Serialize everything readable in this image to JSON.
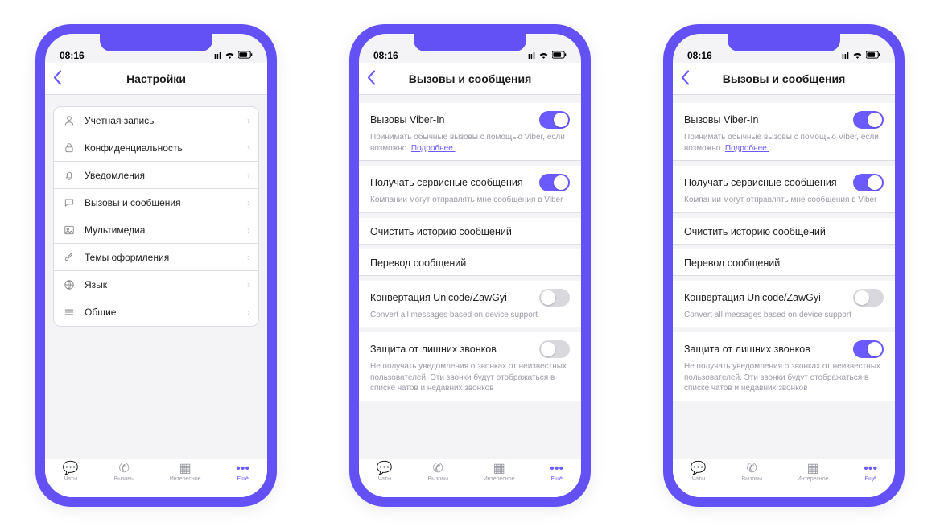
{
  "status": {
    "time": "08:16"
  },
  "phone1": {
    "title": "Настройки",
    "items": [
      {
        "label": "Учетная запись"
      },
      {
        "label": "Конфиденциальность"
      },
      {
        "label": "Уведомления"
      },
      {
        "label": "Вызовы и сообщения"
      },
      {
        "label": "Мультимедиа"
      },
      {
        "label": "Темы оформления"
      },
      {
        "label": "Язык"
      },
      {
        "label": "Общие"
      }
    ]
  },
  "calls": {
    "title": "Вызовы и сообщения",
    "viber_in": {
      "label": "Вызовы Viber-In",
      "desc": "Принимать обычные вызовы с помощью Viber, если возможно.",
      "more": "Подробнее."
    },
    "service_msgs": {
      "label": "Получать сервисные сообщения",
      "desc": "Компании могут отправлять мне сообщения в Viber"
    },
    "clear_history": {
      "label": "Очистить историю сообщений"
    },
    "translate": {
      "label": "Перевод сообщений"
    },
    "unicode": {
      "label": "Конвертация Unicode/ZawGyi",
      "desc": "Convert all messages based on device support"
    },
    "spam_protect": {
      "label": "Защита от лишних звонков",
      "desc": "Не получать уведомления о звонках от неизвестных пользователей. Эти звонки будут отображаться в списке чатов и недавних звонков"
    }
  },
  "tabs": {
    "chats": "Чаты",
    "calls": "Вызовы",
    "interesting": "Интересное",
    "more": "Ещё"
  }
}
